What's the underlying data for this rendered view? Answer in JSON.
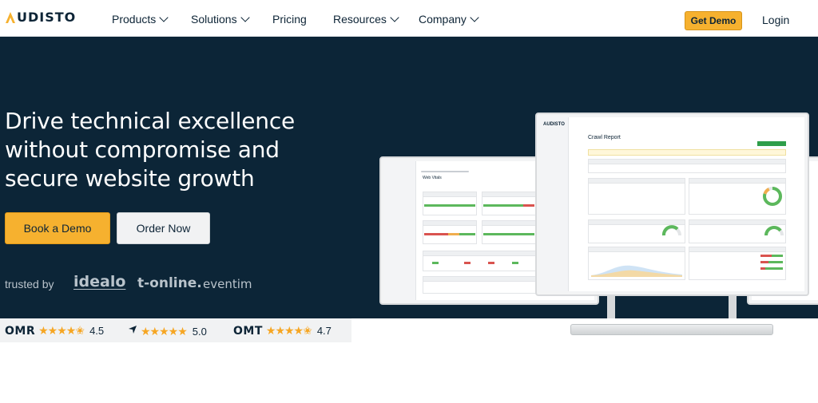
{
  "nav": {
    "logo_text": "UDISTO",
    "items": [
      {
        "label": "Products",
        "dropdown": true
      },
      {
        "label": "Solutions",
        "dropdown": true
      },
      {
        "label": "Pricing",
        "dropdown": false
      },
      {
        "label": "Resources",
        "dropdown": true
      },
      {
        "label": "Company",
        "dropdown": true
      }
    ],
    "get_demo_label": "Get Demo",
    "login_label": "Login"
  },
  "hero": {
    "headline": "Drive technical excellence without compromise and secure website growth",
    "book_demo_label": "Book a Demo",
    "order_now_label": "Order Now",
    "trusted_by_label": "trusted by",
    "brands": [
      "idealo",
      "t-online.",
      "eventim"
    ]
  },
  "screen": {
    "report_title": "Crawl Report",
    "left_title": "Web Vitals",
    "brand": "AUDISTO"
  },
  "ratings": [
    {
      "source": "OMR",
      "value": "4.5",
      "stars": 4.5
    },
    {
      "source": "Capterra",
      "value": "5.0",
      "stars": 5
    },
    {
      "source": "OMT",
      "value": "4.7",
      "stars": 4.5
    }
  ],
  "colors": {
    "hero_bg": "#0c2537",
    "accent": "#f6b12f",
    "text_dark": "#0d2436"
  }
}
